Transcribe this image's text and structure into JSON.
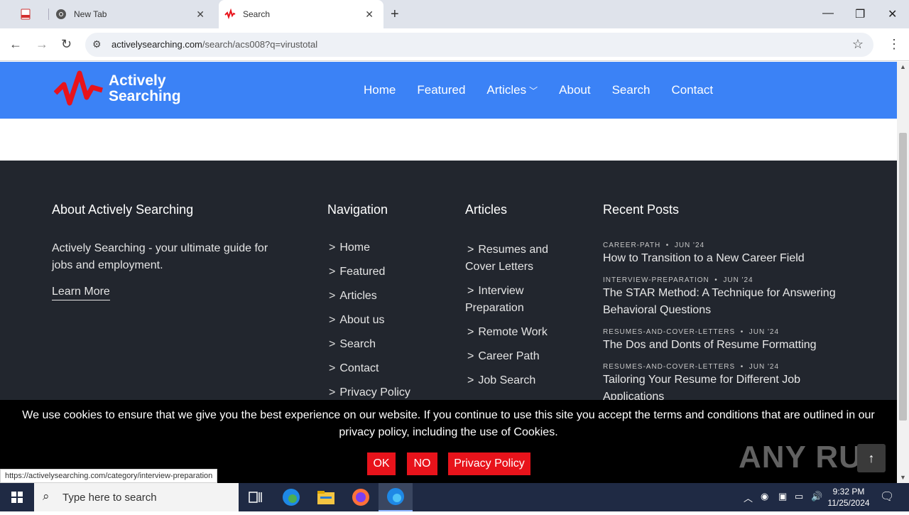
{
  "browser": {
    "tabs": [
      {
        "label": "",
        "icon": "pdf-icon"
      },
      {
        "label": "New Tab",
        "icon": "chrome-icon"
      },
      {
        "label": "Search",
        "icon": "activelysearching-icon"
      }
    ],
    "url_domain": "activelysearching.com",
    "url_path": "/search/acs008?q=virustotal"
  },
  "site": {
    "logo_line1": "Actively",
    "logo_line2": "Searching",
    "nav": [
      "Home",
      "Featured",
      "Articles",
      "About",
      "Search",
      "Contact"
    ],
    "brand_color": "#3b82f6"
  },
  "footer": {
    "about_title": "About Actively Searching",
    "about_text": "Actively Searching - your ultimate guide for jobs and employment.",
    "learn_more": "Learn More",
    "nav_title": "Navigation",
    "nav_links": [
      "Home",
      "Featured",
      "Articles",
      "About us",
      "Search",
      "Contact",
      "Privacy Policy"
    ],
    "articles_title": "Articles",
    "article_links": [
      "Resumes and Cover Letters",
      "Interview Preparation",
      "Remote Work",
      "Career Path",
      "Job Search"
    ],
    "recent_title": "Recent Posts",
    "posts": [
      {
        "category": "CAREER-PATH",
        "date": "JUN '24",
        "title": "How to Transition to a New Career Field"
      },
      {
        "category": "INTERVIEW-PREPARATION",
        "date": "JUN '24",
        "title": "The STAR Method: A Technique for Answering Behavioral Questions"
      },
      {
        "category": "RESUMES-AND-COVER-LETTERS",
        "date": "JUN '24",
        "title": "The Dos and Donts of Resume Formatting"
      },
      {
        "category": "RESUMES-AND-COVER-LETTERS",
        "date": "JUN '24",
        "title": "Tailoring Your Resume for Different Job Applications"
      }
    ]
  },
  "cookie": {
    "text": "We use cookies to ensure that we give you the best experience on our website. If you continue to use this site you accept the terms and conditions that are outlined in our privacy policy, including the use of Cookies.",
    "ok": "OK",
    "no": "NO",
    "policy": "Privacy Policy",
    "button_color": "#e8131b"
  },
  "status_url": "https://activelysearching.com/category/interview-preparation",
  "watermark": "ANY RUN",
  "taskbar": {
    "search_placeholder": "Type here to search",
    "time": "9:32 PM",
    "date": "11/25/2024"
  }
}
